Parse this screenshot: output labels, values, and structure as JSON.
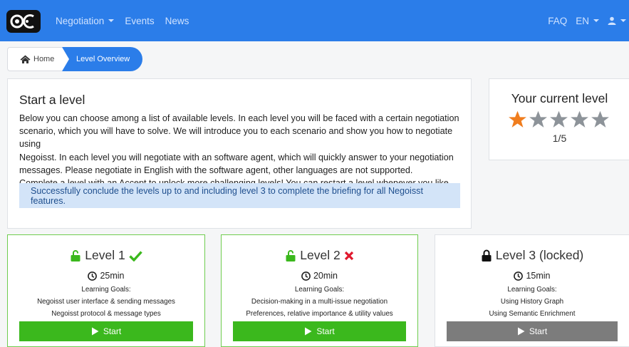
{
  "navbar": {
    "menu": [
      {
        "label": "Negotiation",
        "dropdown": true
      },
      {
        "label": "Events",
        "dropdown": false
      },
      {
        "label": "News",
        "dropdown": false
      }
    ],
    "faq": "FAQ",
    "language": "EN",
    "accent": "#2b7de9"
  },
  "breadcrumb": {
    "home": "Home",
    "current": "Level Overview"
  },
  "intro": {
    "title": "Start a level",
    "lines": [
      "Below you can choose among a list of available levels. In each level you will be faced with a certain negotiation",
      "scenario, which you will have to solve. We will introduce you to each scenario and show you how to negotiate using",
      "Negoisst. In each level you will negotiate with an software agent, which will quickly answer to your negotiation",
      "messages. Please negotiate in English with the software agent, other languages are not supported.",
      "Complete a level with an Accept to unlock more challenging levels! You can restart a level whenever you like."
    ],
    "alert": "Successfully conclude the levels up to and including level 3 to complete the briefing for all Negoisst features."
  },
  "current_level": {
    "title": "Your current level",
    "stars_filled": 1,
    "stars_total": 5,
    "count": "1/5",
    "star_color": "#f07d1e",
    "star_empty_color": "#8d9399"
  },
  "levels": [
    {
      "title": "Level 1",
      "status": "completed",
      "time": "25min",
      "goals_label": "Learning Goals:",
      "goals": [
        "Negoisst user interface & sending messages",
        "Negoisst protocol & message types"
      ],
      "start": "Start"
    },
    {
      "title": "Level 2",
      "status": "failed",
      "time": "20min",
      "goals_label": "Learning Goals:",
      "goals": [
        "Decision-making in a multi-issue negotiation",
        "Preferences, relative importance & utility values"
      ],
      "start": "Start"
    },
    {
      "title": "Level 3 (locked)",
      "status": "locked",
      "time": "15min",
      "goals_label": "Learning Goals:",
      "goals": [
        "Using History Graph",
        "Using Semantic Enrichment"
      ],
      "start": "Start"
    }
  ]
}
